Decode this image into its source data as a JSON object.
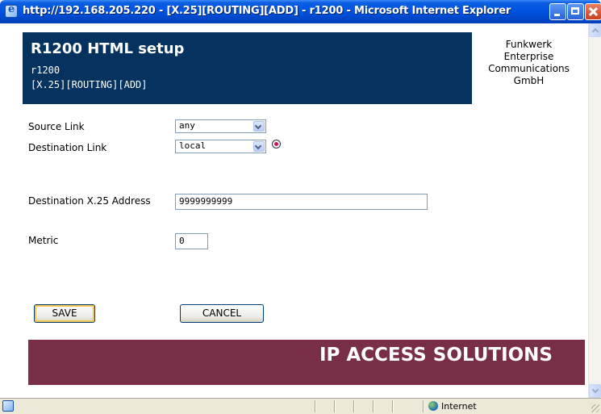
{
  "window": {
    "title": "http://192.168.205.220 - [X.25][ROUTING][ADD] - r1200 - Microsoft Internet Explorer"
  },
  "header": {
    "app_title": "R1200 HTML setup",
    "system_name": "r1200",
    "menu_path": "[X.25][ROUTING][ADD]",
    "company_lines": [
      "Funkwerk",
      "Enterprise",
      "Communications",
      "GmbH"
    ]
  },
  "form": {
    "source_link": {
      "label": "Source Link",
      "value": "any"
    },
    "destination_link": {
      "label": "Destination Link",
      "value": "local"
    },
    "destination_address": {
      "label": "Destination X.25 Address",
      "value": "9999999999"
    },
    "metric": {
      "label": "Metric",
      "value": "0"
    }
  },
  "buttons": {
    "save": "SAVE",
    "cancel": "CANCEL"
  },
  "banner": {
    "text": "IP ACCESS SOLUTIONS"
  },
  "statusbar": {
    "zone": "Internet"
  },
  "colors": {
    "header_bg": "#06325f",
    "banner_bg": "#782e46",
    "titlebar": "#0054e3"
  },
  "icons": [
    "ie-page-icon",
    "help-icon",
    "internet-zone-icon"
  ]
}
